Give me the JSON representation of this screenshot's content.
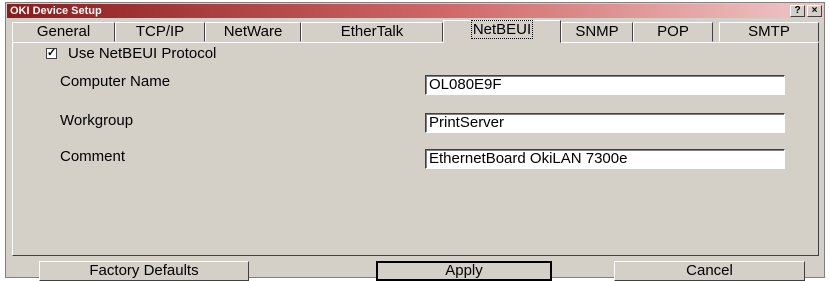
{
  "window": {
    "title": "OKI Device Setup",
    "help_label": "?",
    "close_label": "×"
  },
  "tabs": [
    {
      "label": "General"
    },
    {
      "label": "TCP/IP"
    },
    {
      "label": "NetWare"
    },
    {
      "label": "EtherTalk"
    },
    {
      "label": "NetBEUI"
    },
    {
      "label": "SNMP"
    },
    {
      "label": "POP"
    },
    {
      "label": "SMTP"
    }
  ],
  "netbeui": {
    "use_protocol_label": "Use NetBEUI Protocol",
    "use_protocol_checked": "✓",
    "computer_name_label": "Computer Name",
    "computer_name_value": "OL080E9F",
    "workgroup_label": "Workgroup",
    "workgroup_value": "PrintServer",
    "comment_label": "Comment",
    "comment_value": "EthernetBoard OkiLAN 7300e"
  },
  "buttons": {
    "factory_defaults": "Factory Defaults",
    "apply": "Apply",
    "cancel": "Cancel"
  }
}
